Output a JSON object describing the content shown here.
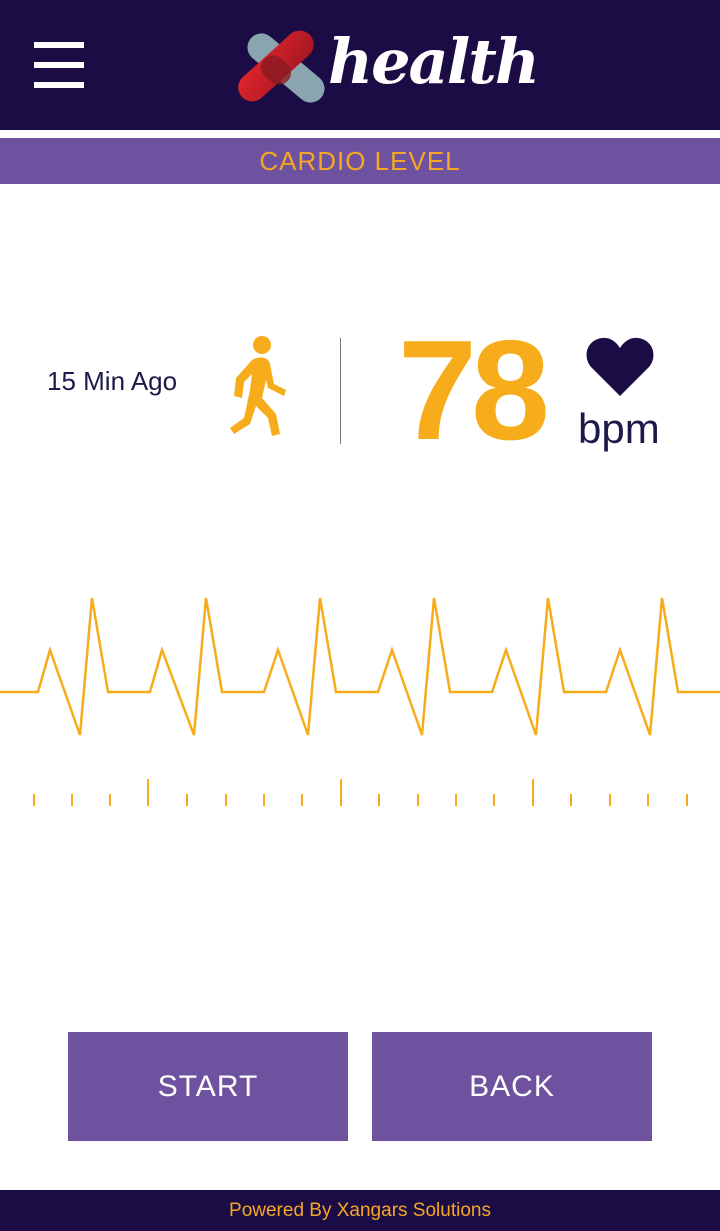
{
  "header": {
    "logo_text": "health",
    "menu_icon": "hamburger-menu-icon"
  },
  "subheader": {
    "title": "CARDIO LEVEL"
  },
  "status": {
    "time_ago": "15 Min Ago",
    "activity_icon": "walking-person-icon",
    "heart_rate": "78",
    "unit": "bpm",
    "heart_icon": "heart-icon"
  },
  "actions": {
    "start_label": "START",
    "back_label": "BACK"
  },
  "footer": {
    "text": "Powered By Xangars Solutions"
  },
  "colors": {
    "header_bg": "#1c0c45",
    "accent_purple": "#6f529f",
    "accent_orange": "#f7ac1c",
    "text_dark": "#1c1a4a"
  }
}
